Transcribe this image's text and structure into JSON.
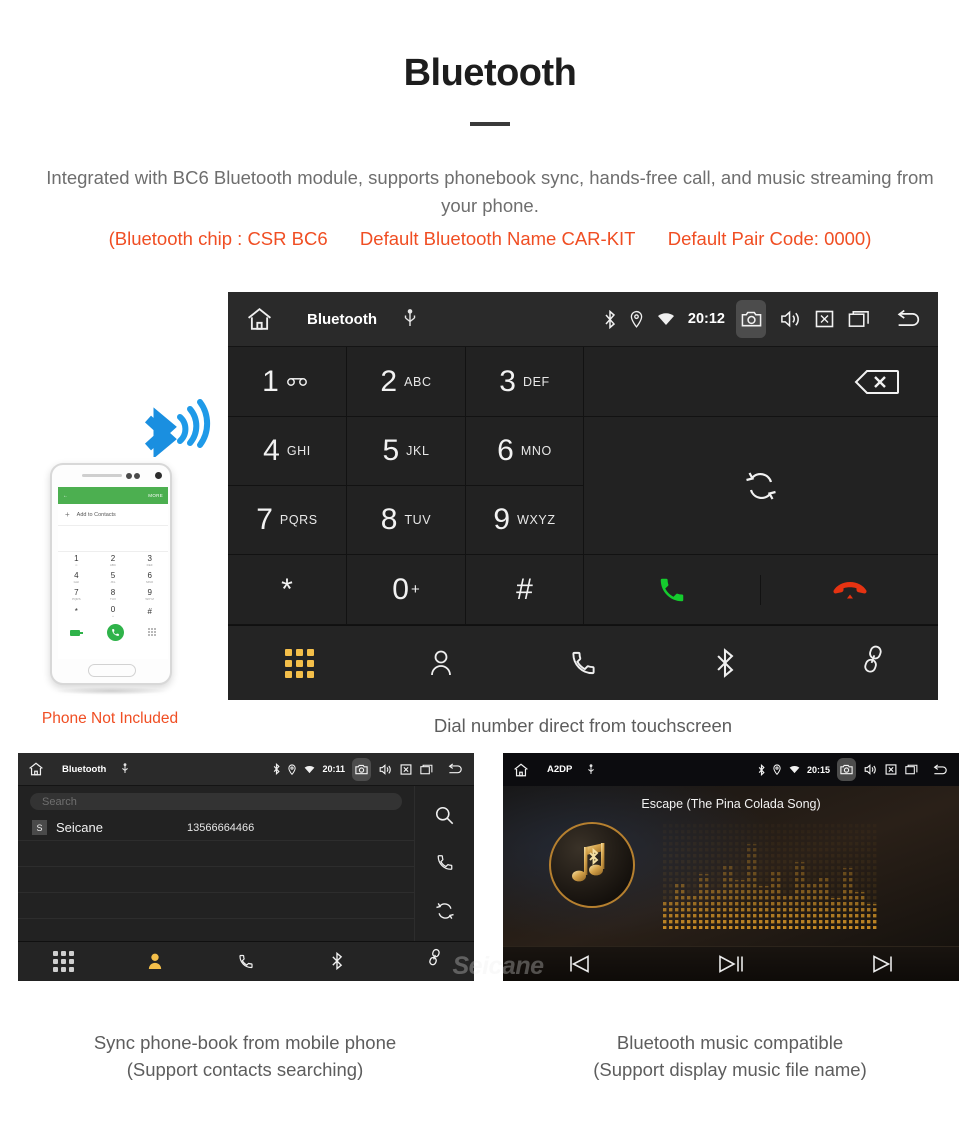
{
  "hero": {
    "title": "Bluetooth",
    "description": "Integrated with BC6 Bluetooth module, supports phonebook sync, hands-free call, and music streaming from your phone.",
    "spec_chip": "(Bluetooth chip : CSR BC6",
    "spec_name": "Default Bluetooth Name CAR-KIT",
    "spec_pair": "Default Pair Code: 0000)",
    "accent_color": "#f04e23",
    "body_color": "#6e6e6e"
  },
  "dialer_screen": {
    "status": {
      "title": "Bluetooth",
      "clock": "20:12",
      "icons_left": [
        "home-icon",
        "usb-icon"
      ],
      "icons_right": [
        "bluetooth-icon",
        "location-icon",
        "wifi-icon",
        "camera-icon",
        "volume-icon",
        "close-box-icon",
        "recents-icon",
        "back-icon"
      ]
    },
    "keys": [
      {
        "digit": "1",
        "letters": "",
        "sub": "voicemail-icon"
      },
      {
        "digit": "2",
        "letters": "ABC",
        "sub": ""
      },
      {
        "digit": "3",
        "letters": "DEF",
        "sub": ""
      },
      {
        "digit": "4",
        "letters": "GHI",
        "sub": ""
      },
      {
        "digit": "5",
        "letters": "JKL",
        "sub": ""
      },
      {
        "digit": "6",
        "letters": "MNO",
        "sub": ""
      },
      {
        "digit": "7",
        "letters": "PQRS",
        "sub": ""
      },
      {
        "digit": "8",
        "letters": "TUV",
        "sub": ""
      },
      {
        "digit": "9",
        "letters": "WXYZ",
        "sub": ""
      },
      {
        "digit": "*",
        "letters": "",
        "sub": ""
      },
      {
        "digit": "0",
        "letters": "",
        "sub": "+"
      },
      {
        "digit": "#",
        "letters": "",
        "sub": ""
      }
    ],
    "actions": [
      "backspace-icon",
      "sync-icon",
      "call-icon",
      "hangup-icon"
    ],
    "call_color": "#15cc2e",
    "hangup_color": "#e63312",
    "nav": [
      {
        "name": "keypad",
        "active": true
      },
      {
        "name": "contacts",
        "active": false
      },
      {
        "name": "call-history",
        "active": false
      },
      {
        "name": "bluetooth",
        "active": false
      },
      {
        "name": "pair-link",
        "active": false
      }
    ],
    "active_color": "#f4bf4a",
    "caption": "Dial number direct from touchscreen"
  },
  "phone_mockup": {
    "app_more": "MORE",
    "add_contacts": "Add to Contacts",
    "keys": [
      {
        "d": "1",
        "s": "∞"
      },
      {
        "d": "2",
        "s": "ABC"
      },
      {
        "d": "3",
        "s": "DEF"
      },
      {
        "d": "4",
        "s": "GHI"
      },
      {
        "d": "5",
        "s": "JKL"
      },
      {
        "d": "6",
        "s": "MNO"
      },
      {
        "d": "7",
        "s": "PQRS"
      },
      {
        "d": "8",
        "s": "TUV"
      },
      {
        "d": "9",
        "s": "WXYZ"
      },
      {
        "d": "*",
        "s": ""
      },
      {
        "d": "0",
        "s": "+"
      },
      {
        "d": "#",
        "s": ""
      }
    ],
    "caption": "Phone Not Included"
  },
  "phonebook_screen": {
    "status": {
      "title": "Bluetooth",
      "clock": "20:11"
    },
    "search_placeholder": "Search",
    "contacts": [
      {
        "initial": "S",
        "name": "Seicane",
        "number": "13566664466"
      }
    ],
    "side_actions": [
      "search-icon",
      "call-icon",
      "sync-icon"
    ],
    "nav": [
      {
        "name": "keypad",
        "active": false
      },
      {
        "name": "contacts",
        "active": true
      },
      {
        "name": "call-history",
        "active": false
      },
      {
        "name": "bluetooth",
        "active": false
      },
      {
        "name": "pair-link",
        "active": false
      }
    ],
    "caption_line1": "Sync phone-book from mobile phone",
    "caption_line2": "(Support contacts searching)"
  },
  "music_screen": {
    "status": {
      "title": "A2DP",
      "clock": "20:15"
    },
    "track_title": "Escape (The Pina Colada Song)",
    "controls": [
      "previous-icon",
      "play-pause-icon",
      "next-icon"
    ],
    "caption_line1": "Bluetooth music compatible",
    "caption_line2": "(Support display music file name)"
  },
  "watermark": {
    "text": "Seicane"
  }
}
